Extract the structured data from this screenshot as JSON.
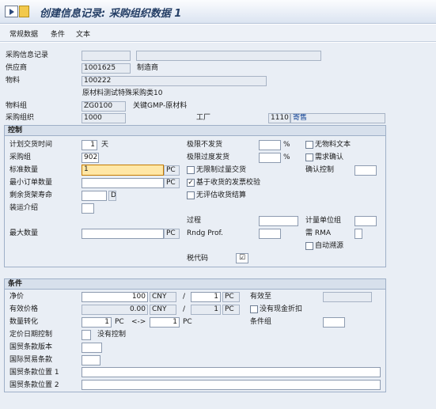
{
  "title": "创建信息记录: 采购组织数据 1",
  "menu": [
    "常规数据",
    "条件",
    "文本"
  ],
  "header": {
    "info_record_label": "采购信息记录",
    "vendor_label": "供应商",
    "vendor_value": "1001625",
    "vendor_name": "制造商",
    "material_label": "物料",
    "material_value": "100222",
    "material_desc": "原材料测试特殊采购类10",
    "material_group_label": "物料组",
    "material_group_value": "ZG0100",
    "material_group_desc": "关键GMP-原材料",
    "purch_org_label": "采购组织",
    "purch_org_value": "1000",
    "plant_label": "工厂",
    "plant_value": "1110",
    "consignment": "寄售"
  },
  "control": {
    "section_title": "控制",
    "plan_delivery_label": "计划交货时间",
    "plan_delivery_value": "1",
    "plan_delivery_unit": "天",
    "purch_group_label": "采购组",
    "purch_group_value": "902",
    "std_qty_label": "标准数量",
    "std_qty_value": "1",
    "std_qty_unit": "PC",
    "min_order_label": "最小订单数量",
    "min_order_unit": "PC",
    "shelf_life_label": "剩余货架寿命",
    "shelf_life_unit": "D",
    "shipping_label": "装运介绍",
    "max_qty_label": "最大数量",
    "max_qty_unit": "PC",
    "under_tol_label": "极限不发货",
    "under_tol_unit": "%",
    "over_tol_label": "极限过度发货",
    "over_tol_unit": "%",
    "unlimited_label": "无限制过量交货",
    "gr_based_iv_label": "基于收货的发票校验",
    "gr_based_iv_checked": true,
    "no_eval_gr_label": "无评估收货结算",
    "no_mat_text_label": "无物料文本",
    "ack_req_label": "需求确认",
    "conf_ctrl_label": "确认控制",
    "procedure_label": "过程",
    "rndg_label": "Rndg Prof.",
    "uom_group_label": "计量单位组",
    "rma_label": "需 RMA",
    "auto_source_label": "自动溯源",
    "tax_code_label": "税代码"
  },
  "conditions": {
    "section_title": "条件",
    "net_price_label": "净价",
    "net_price_value": "100",
    "net_price_currency": "CNY",
    "net_price_per": "1",
    "net_price_uom": "PC",
    "valid_to_label": "有效至",
    "eff_price_label": "有效价格",
    "eff_price_value": "0.00",
    "eff_price_currency": "CNY",
    "eff_price_per": "1",
    "eff_price_uom": "PC",
    "no_cash_disc_label": "没有现金折扣",
    "qty_conv_label": "数量转化",
    "qty_conv_left": "1",
    "qty_conv_left_unit": "PC",
    "qty_conv_arrow": "<->",
    "qty_conv_right": "1",
    "qty_conv_right_unit": "PC",
    "cond_group_label": "条件组",
    "pricing_date_label": "定价日期控制",
    "pricing_date_value": "没有控制",
    "incoterm_ver_label": "国贸条款版本",
    "incoterms_label": "国际贸易条款",
    "incoterm_loc1_label": "国贸条款位置 1",
    "incoterm_loc2_label": "国贸条款位置 2"
  },
  "tax_check": "☑",
  "slash": "/",
  "percent": "%"
}
